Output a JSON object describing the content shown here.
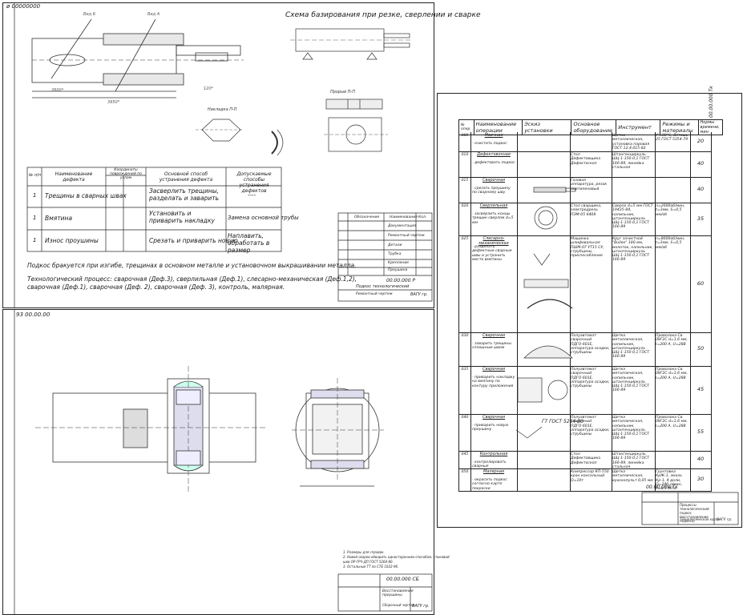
{
  "sheet1": {
    "code": "ø 00000000",
    "scheme_title": "Схема базирования при резке, сверлении и сварке",
    "section_label": "Прорыв П-П",
    "view_label": "Накладка П-П",
    "table_headers": [
      "№ п/п",
      "Наименование дефекта",
      "Координаты повреждений по узлам",
      "Основной способ устранения дефекта",
      "Допускаемые способы устранения дефектов"
    ],
    "table_rows": [
      {
        "n": "1",
        "defect": "Трещины в сварных швах",
        "main": "Засверлить трещины, разделать и заварить",
        "alt": "----"
      },
      {
        "n": "1",
        "defect": "Вмятина",
        "main": "Установить и приварить накладку",
        "alt": "Замена основной трубы"
      },
      {
        "n": "1",
        "defect": "Износ проушины",
        "main": "Срезать и приварить новую",
        "alt": "Наплавить, обработать в размер"
      }
    ],
    "note_line1": "Подкос бракуется при изгибе, трещинах в основном металле и установочном выкрашивании металла.",
    "note_line2": "Технологический процесс: сварочная (Деф.3), сверлильная (Деф.1), слесарно-механическая (Деф.1,2),",
    "note_line3": "сварочная (Деф.1), сварочная (Деф. 2), сварочная (Деф. 3), контроль, малярная.",
    "stamp_code": "00.00.000 Р",
    "stamp_title": "Подкос технологический",
    "stamp_sub": "Ремонтный чертеж",
    "stamp_org": "ВАГУ гр.",
    "spec_headers": [
      "Обозначение",
      "Наименование",
      "Кол."
    ],
    "spec_items": [
      "Документация",
      "Ремонтный чертеж",
      "Детали",
      "Трубка",
      "Крепление",
      "Проушина",
      "Накладка"
    ]
  },
  "sheet2": {
    "code": "93 00.00.00",
    "notes": [
      "1. Размеры для справок.",
      "2. Новой сварки обварить односторонним способом, стыковой",
      "шов ОР-ГРЧ-ДП ГОСТ 5264-80.",
      "3. Остальные ТТ по СТБ 1022-96."
    ],
    "stamp_code": "00.00.000 СБ",
    "stamp_title": "Восстановление проушины",
    "stamp_sub": "Сборочный чертеж",
    "stamp_org": "ВАГУ гр.",
    "label_AA": "A–A"
  },
  "sheet3": {
    "code": "00.00.000 Тк",
    "headers": [
      "№ опер.",
      "Наименование операции",
      "Эскиз установки",
      "Основное оборудование",
      "Инструмент",
      "Режимы и материалы",
      "Нормы времени, мин"
    ],
    "rows": [
      {
        "n": "005",
        "op": "Моечная",
        "op2": "- очистить подкос",
        "equip": "",
        "tool": "Щетка металлическая, установка паровая ГОСТ 12.4.015-82",
        "mode": "t°=80°С, Ветошь 25 ГОСТ 5354-79",
        "norm": "20"
      },
      {
        "n": "010",
        "op": "Дефектовочная",
        "op2": "- дефектовать подкос",
        "equip": "Стол Дефектовщика Дефектоскоп",
        "tool": "Штангенциркуль ШЦ-1-150-0,1 ГОСТ 166-89, линейка стальная",
        "mode": "",
        "norm": "40"
      },
      {
        "n": "015",
        "op": "Сварочная",
        "op2": "- срезать проушину по сварному шву",
        "equip": "Газовая аппаратура, резак ацетиленовый",
        "tool": "",
        "mode": "",
        "norm": "40"
      },
      {
        "n": "020",
        "op": "Сверлильная",
        "op2": "- засверлить концы трещин сверлом d=5 мм",
        "equip": "Стол сварщика, электродрель ПЭМ-05 6408",
        "tool": "Сверло d=5 мм ГОСТ 19435-84, напильник, штангенциркуль ШЦ-1-150-0,1 ГОСТ 166-89",
        "mode": "n=2000об/мин, t=3мм, S=0,5 мм/об",
        "norm": "35"
      },
      {
        "n": "025",
        "op": "Слесарно-механическая",
        "op2": "- разделать дефектные сварные швы и устранить место вмятины",
        "equip": "Машинка шлифовальная ПШМ-07 УТ15 СУ, струбцины, приспособление",
        "tool": "Круг зачистной \"Bullex\" 180 мм, молоток, напильник, штангенциркуль ШЦ-1-150-0,1 ГОСТ 166-89",
        "mode": "n=8000об/мин, t=3мм, S=0,5 мм/об",
        "norm": "60"
      },
      {
        "n": "030",
        "op": "Сварочная",
        "op2": "- заварить трещины сплошным швом",
        "equip": "Полуавтомат сварочный ПДГО-601Е, аппаратура осадки, струбцины",
        "tool": "Щетка металлическая, напильник, штангенциркуль ШЦ-1-150-0,1 ГОСТ 166-89",
        "mode": "Проволока Св 08Г2С d=1,6 мм, I=200 А, U=28В",
        "norm": "50"
      },
      {
        "n": "035",
        "op": "Сварочная",
        "op2": "- приварить накладку на вмятину по контуру приложения",
        "equip": "Полуавтомат сварочный ПДГО-601Е, аппаратура осадки, струбцины",
        "tool": "Щетка металлическая, напильник, штангенциркуль ШЦ-1-150-0,1 ГОСТ 166-89",
        "mode": "Проволока Св 08Г2С d=1,6 мм, I=200 А, U=28В",
        "norm": "45"
      },
      {
        "n": "040",
        "op": "Сварочная",
        "op2": "- приварить новую проушину",
        "equip": "Полуавтомат сварочный ПДГО-601Е, аппаратура осадки, струбцины",
        "tool": "Щетка металлическая, напильник, штангенциркуль ШЦ-1-150-0,1 ГОСТ 166-89",
        "mode": "Проволока Св 08Г2С d=1,6 мм, I=200 А, U=28В",
        "norm": "55"
      },
      {
        "n": "045",
        "op": "Контрольная",
        "op2": "- контролировать сварные",
        "equip": "Стол Дефектовщика Дефектоскоп",
        "tool": "Штангенциркуль ШЦ-1-150-0,1 ГОСТ 166-89, линейка стальная",
        "mode": "",
        "norm": "40"
      },
      {
        "n": "050",
        "op": "Малярная",
        "op2": "- окрасить подкос согласно карте покраски",
        "equip": "Компрессор КП-550 кран консольный Q=10т",
        "tool": "Щетка металлическая, краскопульт 0,05 мм",
        "mode": "Грунтовка КрЖ-1, эмаль Кр-1, 4 доли, Q=240 л/мин, P=0,5 МПа",
        "norm": "30"
      }
    ],
    "weld_note": "Г7 ГОСТ 5264-80",
    "stamp_code": "00.00.000 Тк",
    "stamp_title": "Процессы технологический подкос (восстановление подкоса)",
    "stamp_sub": "Технологическая карта",
    "stamp_org": "ВАГУ гр."
  }
}
